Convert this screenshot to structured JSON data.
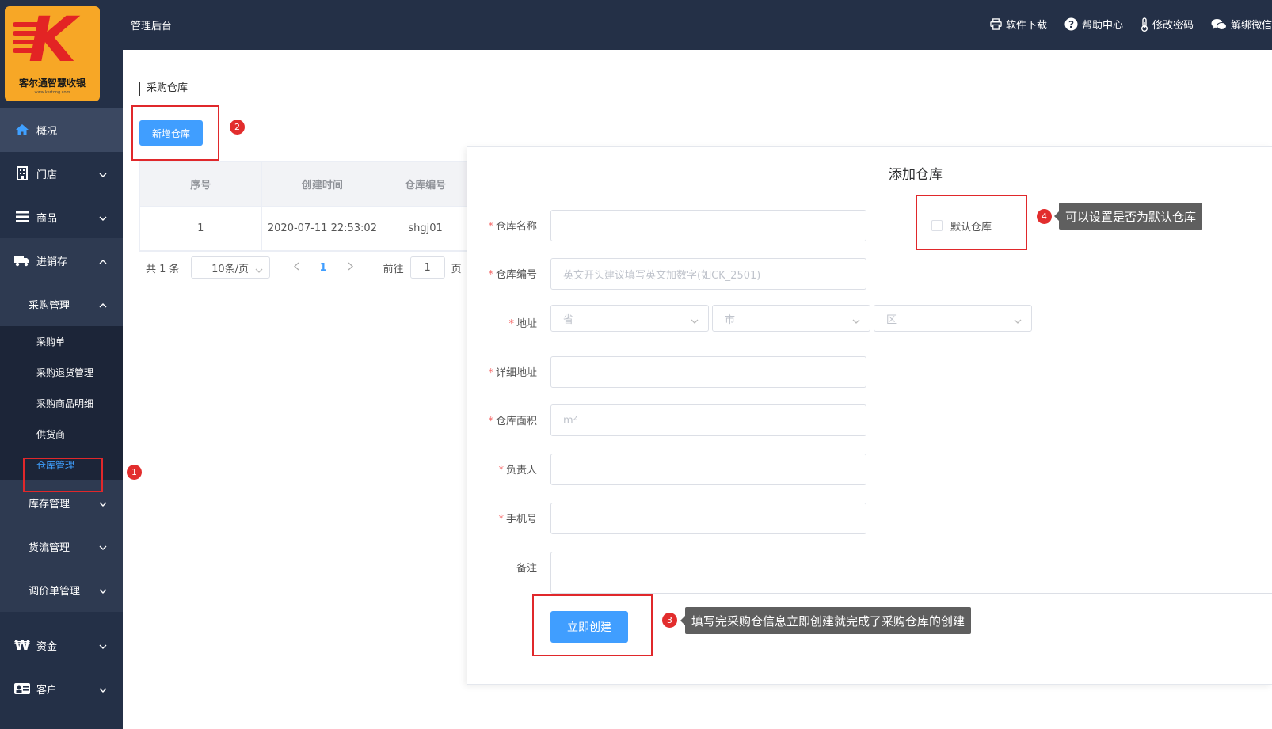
{
  "colors": {
    "sidebar": "#243047",
    "primary": "#409eff",
    "highlight": "#e0282b",
    "tooltip": "#5f5f5f"
  },
  "logo": {
    "brand": "客尔通智慧收银",
    "letter": "K",
    "url": "www.kertong.com"
  },
  "topbar": {
    "title": "管理后台",
    "tools": [
      {
        "icon": "printer-icon",
        "label": "软件下载"
      },
      {
        "icon": "help-icon",
        "label": "帮助中心"
      },
      {
        "icon": "thermometer-icon",
        "label": "修改密码"
      },
      {
        "icon": "wechat-icon",
        "label": "解绑微信"
      }
    ]
  },
  "sidebar": {
    "overview": "概况",
    "store": "门店",
    "goods": "商品",
    "inventory": "进销存",
    "purchase_mgmt": "采购管理",
    "purchase_items": [
      "采购单",
      "采购退货管理",
      "采购商品明细",
      "供货商",
      "仓库管理"
    ],
    "stock_mgmt": "库存管理",
    "logistics_mgmt": "货流管理",
    "price_mgmt": "调价单管理",
    "funds": "资金",
    "customers": "客户"
  },
  "breadcrumb": "采购仓库",
  "add_button": "新增仓库",
  "table": {
    "headers": [
      "序号",
      "创建时间",
      "仓库编号"
    ],
    "rows": [
      [
        "1",
        "2020-07-11 22:53:02",
        "shgj01"
      ]
    ]
  },
  "pager": {
    "total": "共 1 条",
    "page_size": "10条/页",
    "current": "1",
    "goto_prefix": "前往",
    "goto_value": "1",
    "goto_suffix": "页"
  },
  "dialog": {
    "title": "添加仓库",
    "fields": {
      "name": "仓库名称",
      "code": "仓库编号",
      "code_placeholder": "英文开头建议填写英文加数字(如CK_2501)",
      "address": "地址",
      "province": "省",
      "city": "市",
      "district": "区",
      "detail": "详细地址",
      "area": "仓库面积",
      "area_placeholder": "m²",
      "manager": "负责人",
      "phone": "手机号",
      "remark": "备注"
    },
    "default_checkbox": "默认仓库",
    "submit": "立即创建"
  },
  "annotations": {
    "badges": [
      "1",
      "2",
      "3",
      "4"
    ],
    "tip_default": "可以设置是否为默认仓库",
    "tip_submit": "填写完采购仓信息立即创建就完成了采购仓库的创建"
  }
}
